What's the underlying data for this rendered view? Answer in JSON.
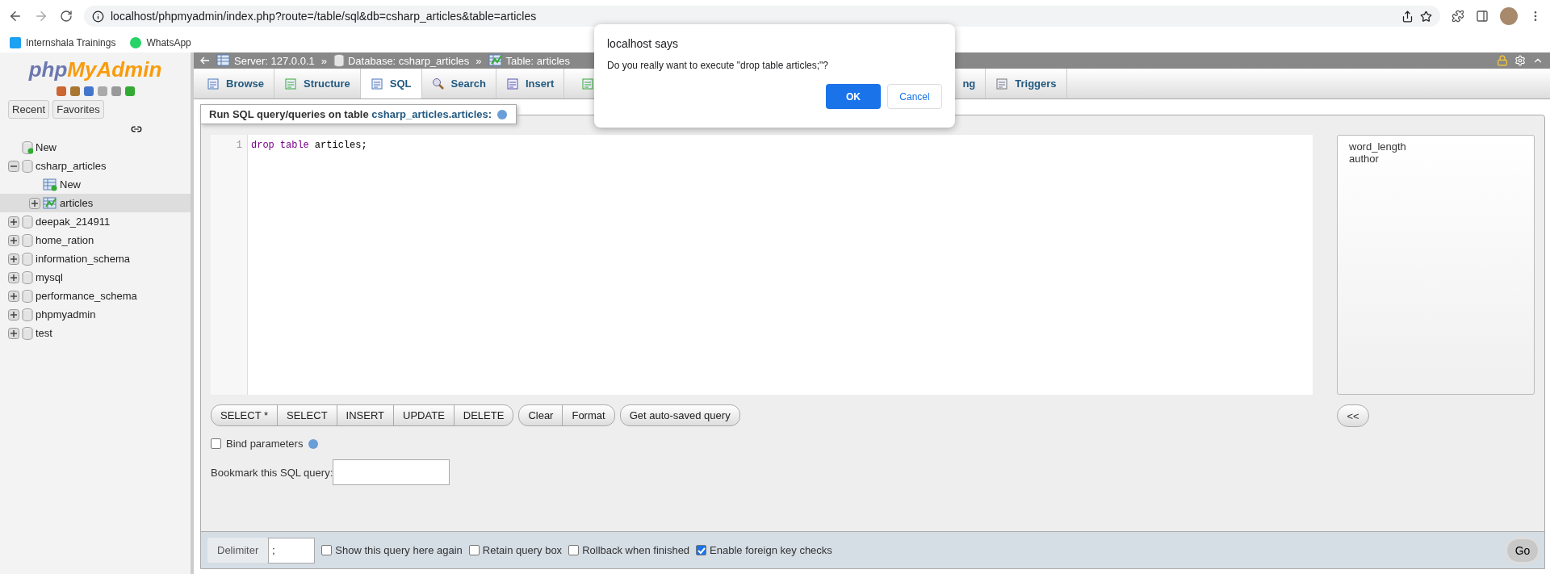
{
  "browser": {
    "url": "localhost/phpmyadmin/index.php?route=/table/sql&db=csharp_articles&table=articles",
    "bookmarks": [
      {
        "label": "Internshala Trainings",
        "kind": "is"
      },
      {
        "label": "WhatsApp",
        "kind": "chat"
      }
    ]
  },
  "sidebar": {
    "logo": {
      "first": "php",
      "second": "MyAdmin"
    },
    "nav_buttons": [
      "Recent",
      "Favorites"
    ],
    "tree": [
      {
        "label": "New",
        "kind": "new-db",
        "selected": false
      },
      {
        "label": "csharp_articles",
        "kind": "db",
        "expanded": true,
        "selected": false,
        "children": [
          {
            "label": "New",
            "kind": "new-table",
            "selected": false
          },
          {
            "label": "articles",
            "kind": "table",
            "expanded": false,
            "selected": true
          }
        ]
      },
      {
        "label": "deepak_214911",
        "kind": "db",
        "expanded": false,
        "selected": false
      },
      {
        "label": "home_ration",
        "kind": "db",
        "expanded": false,
        "selected": false
      },
      {
        "label": "information_schema",
        "kind": "db",
        "expanded": false,
        "selected": false
      },
      {
        "label": "mysql",
        "kind": "db",
        "expanded": false,
        "selected": false
      },
      {
        "label": "performance_schema",
        "kind": "db",
        "expanded": false,
        "selected": false
      },
      {
        "label": "phpmyadmin",
        "kind": "db",
        "expanded": false,
        "selected": false
      },
      {
        "label": "test",
        "kind": "db",
        "expanded": false,
        "selected": false
      }
    ]
  },
  "breadcrumb_separator": "»",
  "breadcrumb": [
    {
      "label": "Server: 127.0.0.1",
      "kind": "server"
    },
    {
      "label": "Database: csharp_articles",
      "kind": "db"
    },
    {
      "label": "Table: articles",
      "kind": "table"
    }
  ],
  "tabs": [
    {
      "label": "Browse",
      "kind": "browse",
      "selected": false
    },
    {
      "label": "Structure",
      "kind": "structure",
      "selected": false
    },
    {
      "label": "SQL",
      "kind": "sql",
      "selected": true
    },
    {
      "label": "Search",
      "kind": "search",
      "selected": false
    },
    {
      "label": "Insert",
      "kind": "insert",
      "selected": false
    },
    {
      "kind": "export",
      "selected": false
    },
    {
      "label": "ng",
      "kind": "covered"
    },
    {
      "label": "Triggers",
      "kind": "triggers",
      "selected": false
    }
  ],
  "query_panel": {
    "title": "Run SQL query/queries on table ",
    "table_link": "csharp_articles.articles:",
    "editor_lines": [
      {
        "number": "1",
        "tokens": [
          {
            "text": "drop",
            "kind": "keyword"
          },
          {
            "text": "table",
            "kind": "keyword"
          },
          {
            "text": "articles;",
            "kind": "plain"
          }
        ]
      }
    ],
    "columns": [
      "word_length",
      "author"
    ],
    "insert_button": "<<",
    "button_groups": [
      [
        "SELECT *",
        "SELECT",
        "INSERT",
        "UPDATE",
        "DELETE"
      ],
      [
        "Clear",
        "Format"
      ],
      [
        "Get auto-saved query"
      ]
    ],
    "bind_parameters": {
      "label": "Bind parameters",
      "checked": false
    },
    "bookmark_label": "Bookmark this SQL query:"
  },
  "footer": {
    "delimiter_label": "Delimiter",
    "delimiter_value": ";",
    "options": [
      {
        "label": "Show this query here again",
        "checked": false
      },
      {
        "label": "Retain query box",
        "checked": false
      },
      {
        "label": "Rollback when finished",
        "checked": false
      },
      {
        "label": "Enable foreign key checks",
        "checked": true
      }
    ],
    "go": "Go"
  },
  "dialog": {
    "title": "localhost says",
    "message": "Do you really want to execute \"drop table articles;\"?",
    "ok": "OK",
    "cancel": "Cancel"
  }
}
